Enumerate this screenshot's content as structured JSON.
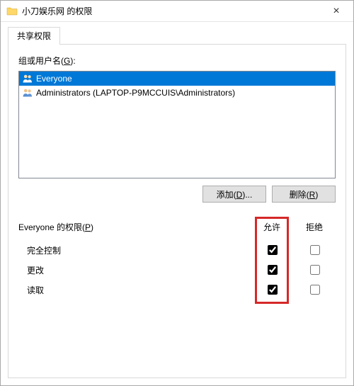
{
  "window": {
    "title": "小刀娱乐网 的权限",
    "close_label": "×"
  },
  "tabs": {
    "share": "共享权限"
  },
  "groups": {
    "label_prefix": "组或用户名(",
    "label_hotkey": "G",
    "label_suffix": "):",
    "items": [
      {
        "name": "Everyone",
        "selected": true,
        "iconColor": "#3a7bd5"
      },
      {
        "name": "Administrators (LAPTOP-P9MCCUIS\\Administrators)",
        "selected": false,
        "iconColor": "#3a7bd5"
      }
    ]
  },
  "buttons": {
    "add_prefix": "添加(",
    "add_hotkey": "D",
    "add_suffix": ")...",
    "remove_prefix": "删除(",
    "remove_hotkey": "R",
    "remove_suffix": ")"
  },
  "permissions": {
    "label_prefix": "Everyone 的权限(",
    "label_hotkey": "P",
    "label_suffix": ")",
    "col_allow": "允许",
    "col_deny": "拒绝",
    "rows": [
      {
        "name": "完全控制",
        "allow": true,
        "deny": false
      },
      {
        "name": "更改",
        "allow": true,
        "deny": false
      },
      {
        "name": "读取",
        "allow": true,
        "deny": false
      }
    ]
  }
}
